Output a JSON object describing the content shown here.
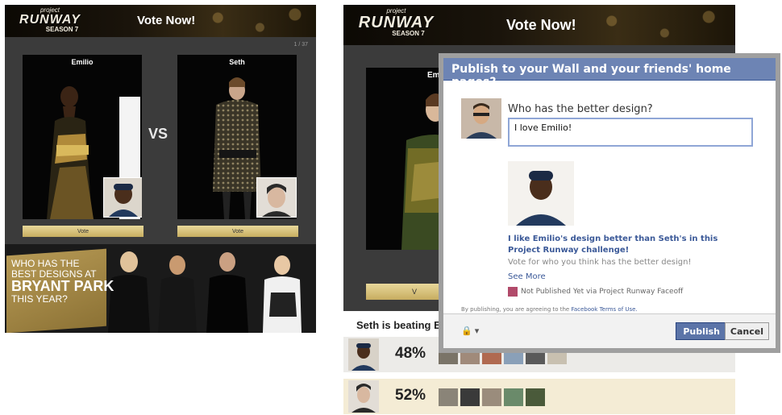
{
  "left_app": {
    "logo": {
      "line1": "project",
      "line2": "RUNWAY",
      "line3": "SEASON 7"
    },
    "title": "Vote Now!",
    "counter": "1 / 37",
    "contestants": [
      {
        "name": "Emilio",
        "vote_label": "Vote"
      },
      {
        "name": "Seth",
        "vote_label": "Vote"
      }
    ],
    "vs": "VS",
    "promo": {
      "line1": "WHO HAS THE",
      "line2": "BEST DESIGNS AT",
      "line3": "BRYANT PARK",
      "line4": "THIS YEAR?"
    }
  },
  "right_app": {
    "logo": {
      "line1": "project",
      "line2": "RUNWAY",
      "line3": "SEASON 7"
    },
    "title": "Vote Now!",
    "name_partial": "Emi",
    "vote_partial": "V",
    "beating_text": "Seth is beating E",
    "results": [
      {
        "percent": "48%"
      },
      {
        "percent": "52%"
      }
    ]
  },
  "dialog": {
    "title": "Publish to your Wall and your friends' home pages?",
    "prompt": "Who has the better design?",
    "message_value": "I love Emilio!",
    "attachment_title": "I like Emilio's design better than Seth's in this Project Runway challenge!",
    "attachment_desc": "Vote for who you think has the better design!",
    "see_more": "See More",
    "publish_status": "Not Published Yet via Project Runway Faceoff",
    "terms_prefix": "By publishing, you are agreeing to the",
    "terms_link": "Facebook Terms of Use.",
    "privacy_icon": "lock-icon",
    "publish_label": "Publish",
    "cancel_label": "Cancel"
  },
  "colors": {
    "fb_header": "#6d84b4",
    "fb_link": "#3b5998",
    "vote_button": "#d8c27a",
    "promo_gold": "#a88b48"
  }
}
